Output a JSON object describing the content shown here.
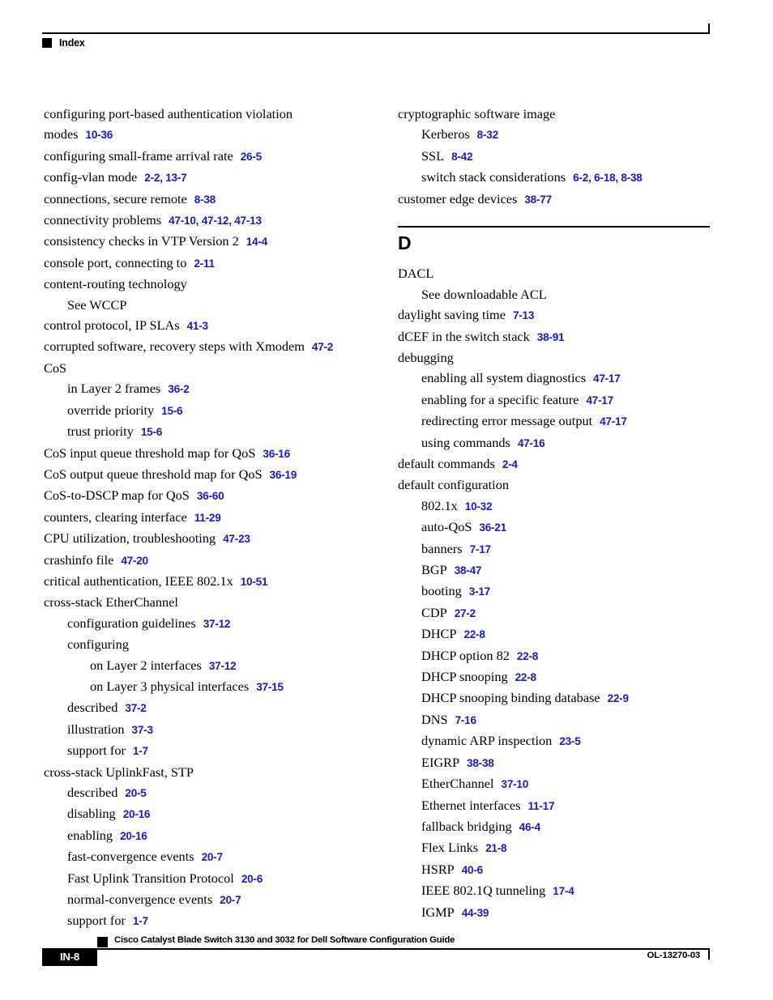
{
  "header": {
    "label": "Index"
  },
  "columns": [
    {
      "name": "left-column",
      "letter_heading": null,
      "entries": [
        {
          "level": 0,
          "term": "configuring port-based authentication violation modes",
          "pages": "10-36"
        },
        {
          "level": 0,
          "term": "configuring small-frame arrival rate",
          "pages": "26-5"
        },
        {
          "level": 0,
          "term": "config-vlan mode",
          "pages": "2-2, 13-7"
        },
        {
          "level": 0,
          "term": "connections, secure remote",
          "pages": "8-38"
        },
        {
          "level": 0,
          "term": "connectivity problems",
          "pages": "47-10, 47-12, 47-13"
        },
        {
          "level": 0,
          "term": "consistency checks in VTP Version 2",
          "pages": "14-4"
        },
        {
          "level": 0,
          "term": "console port, connecting to",
          "pages": "2-11"
        },
        {
          "level": 0,
          "term": "content-routing technology",
          "pages": ""
        },
        {
          "level": 1,
          "term": "See WCCP",
          "pages": ""
        },
        {
          "level": 0,
          "term": "control protocol, IP SLAs",
          "pages": "41-3"
        },
        {
          "level": 0,
          "term": "corrupted software, recovery steps with Xmodem",
          "pages": "47-2"
        },
        {
          "level": 0,
          "term": "CoS",
          "pages": ""
        },
        {
          "level": 1,
          "term": "in Layer 2 frames",
          "pages": "36-2"
        },
        {
          "level": 1,
          "term": "override priority",
          "pages": "15-6"
        },
        {
          "level": 1,
          "term": "trust priority",
          "pages": "15-6"
        },
        {
          "level": 0,
          "term": "CoS input queue threshold map for QoS",
          "pages": "36-16"
        },
        {
          "level": 0,
          "term": "CoS output queue threshold map for QoS",
          "pages": "36-19"
        },
        {
          "level": 0,
          "term": "CoS-to-DSCP map for QoS",
          "pages": "36-60"
        },
        {
          "level": 0,
          "term": "counters, clearing interface",
          "pages": "11-29"
        },
        {
          "level": 0,
          "term": "CPU utilization, troubleshooting",
          "pages": "47-23"
        },
        {
          "level": 0,
          "term": "crashinfo file",
          "pages": "47-20"
        },
        {
          "level": 0,
          "term": "critical authentication, IEEE 802.1x",
          "pages": "10-51"
        },
        {
          "level": 0,
          "term": "cross-stack EtherChannel",
          "pages": ""
        },
        {
          "level": 1,
          "term": "configuration guidelines",
          "pages": "37-12"
        },
        {
          "level": 1,
          "term": "configuring",
          "pages": ""
        },
        {
          "level": 2,
          "term": "on Layer 2 interfaces",
          "pages": "37-12"
        },
        {
          "level": 2,
          "term": "on Layer 3 physical interfaces",
          "pages": "37-15"
        },
        {
          "level": 1,
          "term": "described",
          "pages": "37-2"
        },
        {
          "level": 1,
          "term": "illustration",
          "pages": "37-3"
        },
        {
          "level": 1,
          "term": "support for",
          "pages": "1-7"
        },
        {
          "level": 0,
          "term": "cross-stack UplinkFast, STP",
          "pages": ""
        },
        {
          "level": 1,
          "term": "described",
          "pages": "20-5"
        },
        {
          "level": 1,
          "term": "disabling",
          "pages": "20-16"
        },
        {
          "level": 1,
          "term": "enabling",
          "pages": "20-16"
        },
        {
          "level": 1,
          "term": "fast-convergence events",
          "pages": "20-7"
        },
        {
          "level": 1,
          "term": "Fast Uplink Transition Protocol",
          "pages": "20-6"
        },
        {
          "level": 1,
          "term": "normal-convergence events",
          "pages": "20-7"
        },
        {
          "level": 1,
          "term": "support for",
          "pages": "1-7"
        }
      ]
    },
    {
      "name": "right-column",
      "entries_before_letter": [
        {
          "level": 0,
          "term": "cryptographic software image",
          "pages": ""
        },
        {
          "level": 1,
          "term": "Kerberos",
          "pages": "8-32"
        },
        {
          "level": 1,
          "term": "SSL",
          "pages": "8-42"
        },
        {
          "level": 1,
          "term": "switch stack considerations",
          "pages": "6-2, 6-18, 8-38"
        },
        {
          "level": 0,
          "term": "customer edge devices",
          "pages": "38-77"
        }
      ],
      "letter_heading": "D",
      "entries": [
        {
          "level": 0,
          "term": "DACL",
          "pages": ""
        },
        {
          "level": 1,
          "term": "See downloadable ACL",
          "pages": ""
        },
        {
          "level": 0,
          "term": "daylight saving time",
          "pages": "7-13"
        },
        {
          "level": 0,
          "term": "dCEF in the switch stack",
          "pages": "38-91"
        },
        {
          "level": 0,
          "term": "debugging",
          "pages": ""
        },
        {
          "level": 1,
          "term": "enabling all system diagnostics",
          "pages": "47-17"
        },
        {
          "level": 1,
          "term": "enabling for a specific feature",
          "pages": "47-17"
        },
        {
          "level": 1,
          "term": "redirecting error message output",
          "pages": "47-17"
        },
        {
          "level": 1,
          "term": "using commands",
          "pages": "47-16"
        },
        {
          "level": 0,
          "term": "default commands",
          "pages": "2-4"
        },
        {
          "level": 0,
          "term": "default configuration",
          "pages": ""
        },
        {
          "level": 1,
          "term": "802.1x",
          "pages": "10-32"
        },
        {
          "level": 1,
          "term": "auto-QoS",
          "pages": "36-21"
        },
        {
          "level": 1,
          "term": "banners",
          "pages": "7-17"
        },
        {
          "level": 1,
          "term": "BGP",
          "pages": "38-47"
        },
        {
          "level": 1,
          "term": "booting",
          "pages": "3-17"
        },
        {
          "level": 1,
          "term": "CDP",
          "pages": "27-2"
        },
        {
          "level": 1,
          "term": "DHCP",
          "pages": "22-8"
        },
        {
          "level": 1,
          "term": "DHCP option 82",
          "pages": "22-8"
        },
        {
          "level": 1,
          "term": "DHCP snooping",
          "pages": "22-8"
        },
        {
          "level": 1,
          "term": "DHCP snooping binding database",
          "pages": "22-9"
        },
        {
          "level": 1,
          "term": "DNS",
          "pages": "7-16"
        },
        {
          "level": 1,
          "term": "dynamic ARP inspection",
          "pages": "23-5"
        },
        {
          "level": 1,
          "term": "EIGRP",
          "pages": "38-38"
        },
        {
          "level": 1,
          "term": "EtherChannel",
          "pages": "37-10"
        },
        {
          "level": 1,
          "term": "Ethernet interfaces",
          "pages": "11-17"
        },
        {
          "level": 1,
          "term": "fallback bridging",
          "pages": "46-4"
        },
        {
          "level": 1,
          "term": "Flex Links",
          "pages": "21-8"
        },
        {
          "level": 1,
          "term": "HSRP",
          "pages": "40-6"
        },
        {
          "level": 1,
          "term": "IEEE 802.1Q tunneling",
          "pages": "17-4"
        },
        {
          "level": 1,
          "term": "IGMP",
          "pages": "44-39"
        }
      ]
    }
  ],
  "footer": {
    "title": "Cisco Catalyst Blade Switch 3130 and 3032 for Dell Software Configuration Guide",
    "page_number": "IN-8",
    "document_id": "OL-13270-03"
  },
  "colors": {
    "page_reference_blue": "#1a19cc",
    "text_black": "#000000",
    "background": "#ffffff"
  }
}
